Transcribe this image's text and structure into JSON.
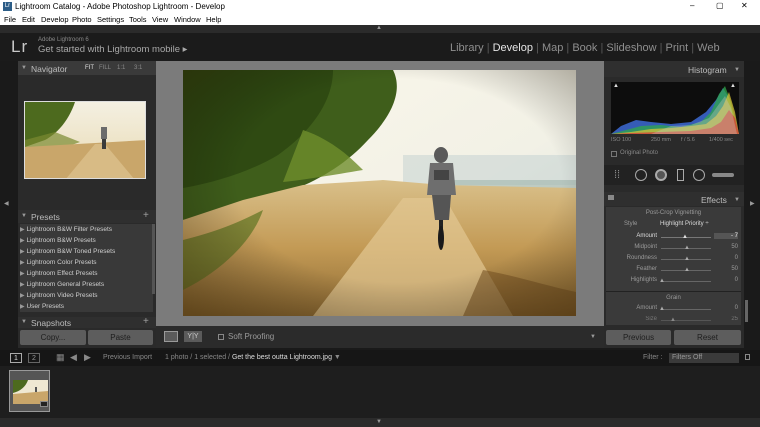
{
  "window": {
    "title": "Lightroom Catalog - Adobe Photoshop Lightroom - Develop",
    "controls": [
      "–",
      "▢",
      "✕"
    ]
  },
  "menu": [
    "File",
    "Edit",
    "Develop",
    "Photo",
    "Settings",
    "Tools",
    "View",
    "Window",
    "Help"
  ],
  "identity": {
    "logo": "Lr",
    "product": "Adobe Lightroom 6",
    "tagline": "Get started with Lightroom mobile ▸"
  },
  "modules": [
    "Library",
    "Develop",
    "Map",
    "Book",
    "Slideshow",
    "Print",
    "Web"
  ],
  "active_module": "Develop",
  "navigator": {
    "title": "Navigator",
    "zoom": [
      "FIT",
      "FILL",
      "1:1",
      "3:1"
    ]
  },
  "presets": {
    "title": "Presets",
    "items": [
      "Lightroom B&W Filter Presets",
      "Lightroom B&W Presets",
      "Lightroom B&W Toned Presets",
      "Lightroom Color Presets",
      "Lightroom Effect Presets",
      "Lightroom General Presets",
      "Lightroom Video Presets",
      "User Presets"
    ]
  },
  "snapshots": {
    "title": "Snapshots"
  },
  "left_buttons": {
    "copy": "Copy...",
    "paste": "Paste"
  },
  "toolbar": {
    "soft_proofing": "Soft Proofing",
    "yy": "Y|Y"
  },
  "histogram": {
    "title": "Histogram",
    "iso": "ISO 100",
    "focal": "250 mm",
    "aperture": "f / 5.6",
    "shutter": "1/400 sec",
    "original": "Original Photo"
  },
  "effects": {
    "title": "Effects",
    "vignette_title": "Post-Crop Vignetting",
    "style_label": "Style",
    "style_value": "Highlight Priority ÷",
    "rows": [
      {
        "label": "Amount",
        "value": "- 7",
        "pos": 0.46
      },
      {
        "label": "Midpoint",
        "value": "50",
        "pos": 0.5
      },
      {
        "label": "Roundness",
        "value": "0",
        "pos": 0.5
      },
      {
        "label": "Feather",
        "value": "50",
        "pos": 0.5
      },
      {
        "label": "Highlights",
        "value": "0",
        "pos": 0.0
      }
    ],
    "grain_title": "Grain",
    "grain_rows": [
      {
        "label": "Amount",
        "value": "0",
        "pos": 0.0
      },
      {
        "label": "Size",
        "value": "25",
        "pos": 0.25
      }
    ]
  },
  "right_buttons": {
    "previous": "Previous",
    "reset": "Reset"
  },
  "filmstrip": {
    "page1": "1",
    "page2": "2",
    "source": "Previous Import",
    "status_prefix": "1 photo / 1 selected /",
    "filename": "Get the best outta Lightroom.jpg",
    "filter_label": "Filter :",
    "filter_value": "Filters Off"
  },
  "colors": {
    "accent": "#d4d4d4",
    "panel": "#2a2a2a",
    "bg": "#1a1a1a"
  }
}
